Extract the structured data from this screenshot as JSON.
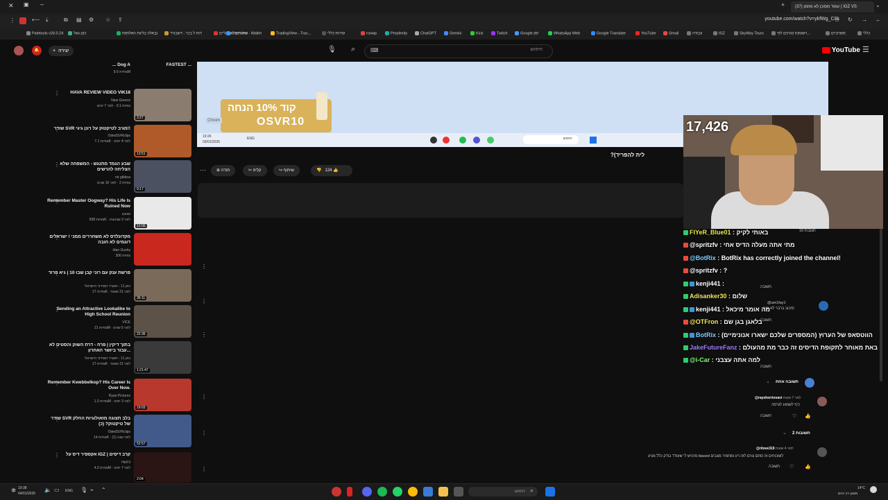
{
  "browser": {
    "tab_title": "(37) עמוד מסוכן לא מוזמן | IGZ VS",
    "url": "youtube.com/watch?v=ykfWg_C8k",
    "bookmarks": [
      "Paletools v26.0.24",
      "כונן גוגל",
      "נבאלה בליגת האלופות",
      "דוח ל בכר - דשבורד",
      "שירותים ישראליים",
      "Overview - Wallet",
      "TradingView - Trac...",
      "שירות כללי",
      "roowp",
      "Perplexity",
      "ChatGPT",
      "Gemini",
      "Kick",
      "Twitch",
      "Google זמן",
      "WhatsApp Web",
      "Google Translate",
      "YouTube",
      "Gmail",
      "עבודה",
      "IGZ",
      "SkyWay Tours",
      "רשומות טורנים לפי...",
      "משרוניים",
      "כללי"
    ]
  },
  "youtube": {
    "logo": "YouTube",
    "create_label": "יצירה",
    "search_placeholder": "חיפוש"
  },
  "recommendations": [
    {
      "title": "... Dog A",
      "title2": "FASTEST ...",
      "channel": "",
      "meta": "צפיות 9.6M",
      "dur": ""
    },
    {
      "title": "HAVA REVIEW VIDEO VIK18",
      "channel": "New Greece",
      "meta": "צפיות 9.1 · לפני 7 ימים",
      "dur": "3:27"
    },
    {
      "title": "שודר SVR מגיב לטיקטוק על רונן גיגי!!",
      "channel": "OdedSVRclips",
      "meta": "צפיות 7.1K · לפני 4 ימים",
      "dur": "13:51"
    },
    {
      "title": "שבע הגמד מתנגש - המשפחה שלא הצליחה להרשים",
      "channel": "nir gibboa",
      "meta": "צפיות 2 · לפני 10 שנים",
      "dur": "9:17"
    },
    {
      "title": "Remember Master Oogway? His Life Is Ruined Now",
      "channel": "curse",
      "meta": "צפיות 598K · לפני 3 שבועות",
      "dur": "12:06"
    },
    {
      "title": "מקדונלדס לא משחררים ממני ! ישראלים דוגמים לא חובה",
      "channel": "Idan Gushy",
      "meta": "צפיות 306",
      "dur": ""
    },
    {
      "title": "פרשת ענק עם רוני קבן שבו 10 | גיא פרוד",
      "channel": "כאן 11 - תאגיד השידור הישראלי",
      "meta": "צפיות 17K · לפני 21 שעות",
      "dur": "36:11"
    },
    {
      "title": "Sending an Attractive Lookalike to High School Reunion",
      "channel": "VICE",
      "meta": "צפיות 21M · לפני 5 שנים",
      "dur": "22:36"
    },
    {
      "title": "בתוך דיקין | פרח - דרת השוק והסטים לא עבור ביושר האחרון...",
      "channel": "כאן 11 - תאגיד השידור הישראלי",
      "meta": "צפיות 17K · לפני 21 שעות",
      "dur": "1:21:47"
    },
    {
      "title": "Remember Kwebbelkop? His Career Is Over Now.",
      "channel": "Ryan Pictures",
      "meta": "צפיות 1.3M · לפני 3 ימים",
      "dur": "19:03"
    },
    {
      "title": "שודר SVR בלב תצוגה מזאולוגיות החלק של טיקטוק? (כ)",
      "channel": "OdedSVRclips",
      "meta": "צפיות 14K · לפני שנה (1)",
      "dur": "52:57"
    },
    {
      "title": "אקספיר דיס על IGZ | קרב דיסים",
      "channel": "Hell II",
      "meta": "צפיות 4.3M · לפני 7 ימים",
      "dur": "2:04"
    }
  ],
  "player": {
    "ad_line1": "קוד 10% הנחה",
    "ad_line2": "OSVR10",
    "chrome_chip": "Chrom",
    "mini_time": "19:26",
    "mini_date": "03/01/2026",
    "mini_lang": "ENG",
    "mini_search": "חיפוש"
  },
  "video": {
    "title_fragment": "?(לית להפריד",
    "likes": "124",
    "share_label": "שיתוף",
    "clip_label": "קליפ",
    "thanks_label": "תודה"
  },
  "stream": {
    "viewers": "17,426"
  },
  "chat": [
    {
      "user": "FIYeR_Blue01",
      "text": "באותי לקיק",
      "color": "#e8e84a",
      "badge": "#2ecc71"
    },
    {
      "user": "@spritzfv",
      "text": "מתי אתה מעלה הדיס אחי",
      "color": "#ffffff",
      "badge": "#e74c3c"
    },
    {
      "user": "@BotRix",
      "text": "BotRix has correctly joined the channel!",
      "color": "#7fd1ff",
      "badge": "#e74c3c"
    },
    {
      "user": "@spritzfv",
      "text": "?",
      "color": "#ffffff",
      "badge": "#e74c3c"
    },
    {
      "user": "kenji441",
      "text": "",
      "color": "#ffffff",
      "badge": "#2ecc71"
    },
    {
      "user": "Adisanker30",
      "text": "שלום",
      "color": "#f5e663",
      "badge": "#2ecc71"
    },
    {
      "user": "kenji441",
      "text": "מה אומר מיכאל",
      "color": "#ffffff",
      "badge": "#2ecc71"
    },
    {
      "user": "@OTFron",
      "text": "בלאגן בגן שם",
      "color": "#f5e663",
      "badge": "#e74c3c"
    },
    {
      "user": "BotRix",
      "text": "הווטסאפ של הערוץ (המספרים שלכם ישארו אנונימיים)",
      "color": "#7fd1ff",
      "badge": "#2ecc71"
    },
    {
      "user": "JakeFutureFanz",
      "text": "באת מאוחר לתקופת הדיסים זה כבר מת מהעולם",
      "color": "#a07cff",
      "badge": "#2ecc71"
    },
    {
      "user": "@i-Car",
      "text": "למה אתה עצבני",
      "color": "#7fff7f",
      "badge": "#2ecc71"
    }
  ],
  "comments": {
    "count_label": "10 תגובות",
    "reply_label": "תשובה",
    "one_reply": "תשובה אחת",
    "two_replies": "2 תשובות",
    "c1_user": "@raysherrtovavi",
    "c1_time": "לפני 7 שעות",
    "c1_text": "כיף לשמוע לגרסה",
    "c2_user": "@rilove319",
    "c2_time": "לפני 4 שעות",
    "c2_text": "מרגיש לי שעודד בודק כלל מגיע biased לשוכוחים זה סתם גורם לזה רע ומחמיר מצבים",
    "c3_user": "@am1fay1",
    "c3_text": "סיבוב ברבר לא כנה"
  },
  "taskbar": {
    "time": "19:38",
    "date": "04/01/2026",
    "lang": "ENG",
    "search": "חיפוש",
    "weather": "14°C",
    "weather_note": "מעונן רב היום"
  }
}
